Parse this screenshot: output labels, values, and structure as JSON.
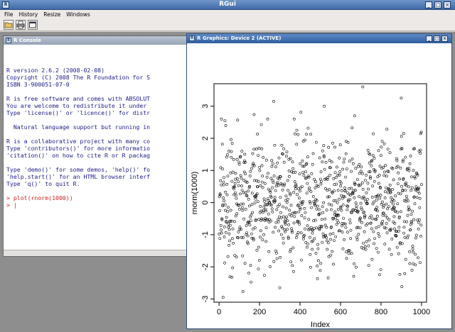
{
  "window": {
    "title": "RGui",
    "icon": "R"
  },
  "menu": [
    "File",
    "History",
    "Resize",
    "Windows"
  ],
  "toolbar": {
    "icons": [
      "open-script-icon",
      "print-icon",
      "new-window-icon"
    ]
  },
  "console": {
    "title": "R Console",
    "lines": [
      "",
      "R version 2.6.2 (2008-02-08)",
      "Copyright (C) 2008 The R Foundation for S",
      "ISBN 3-900051-07-0",
      "",
      "R is free software and comes with ABSOLUT",
      "You are welcome to redistribute it under",
      "Type 'license()' or 'licence()' for distr",
      "",
      "  Natural language support but running in",
      "",
      "R is a collaborative project with many co",
      "Type 'contributors()' for more informatio",
      "'citation()' on how to cite R or R packag",
      "",
      "Type 'demo()' for some demos, 'help()' fo",
      "'help.start()' for an HTML browser interf",
      "Type 'q()' to quit R.",
      ""
    ],
    "command": "> plot(rnorm(1000))",
    "prompt": "> |"
  },
  "graphics": {
    "title": "R Graphics: Device 2 (ACTIVE)",
    "controls": [
      "_",
      "□",
      "×"
    ]
  },
  "chart_data": {
    "type": "scatter",
    "xlabel": "Index",
    "ylabel": "rnorm(1000)",
    "xlim": [
      0,
      1000
    ],
    "ylim": [
      -3,
      3.5
    ],
    "xticks": [
      0,
      200,
      400,
      600,
      800,
      1000
    ],
    "yticks": [
      -3,
      -2,
      -1,
      0,
      1,
      2,
      3
    ],
    "n_points": 1000,
    "notable_points": [
      {
        "x": 12,
        "y": 2.6
      },
      {
        "x": 20,
        "y": -2.95
      },
      {
        "x": 270,
        "y": 3.15
      },
      {
        "x": 300,
        "y": -2.65
      },
      {
        "x": 710,
        "y": 3.6
      },
      {
        "x": 900,
        "y": 3.25
      },
      {
        "x": 520,
        "y": 3.0
      },
      {
        "x": 240,
        "y": 2.6
      }
    ],
    "grid": false,
    "point_style": "open-circle"
  }
}
